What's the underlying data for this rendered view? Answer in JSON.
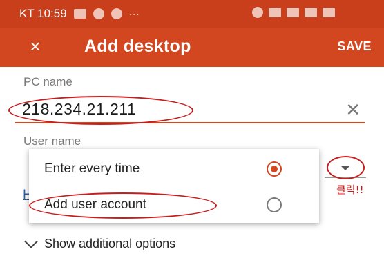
{
  "status_bar": {
    "carrier_time": "KT 10:59",
    "more": "···"
  },
  "app_bar": {
    "close_icon": "×",
    "title": "Add desktop",
    "save_label": "SAVE"
  },
  "form": {
    "pc_name_label": "PC name",
    "pc_name_value": "218.234.21.211",
    "clear_icon": "✕",
    "user_name_label": "User name"
  },
  "menu": {
    "items": [
      {
        "label": "Enter every time",
        "selected": true
      },
      {
        "label": "Add user account",
        "selected": false
      }
    ]
  },
  "annotation": {
    "click_text": "클릭!!",
    "color": "#c81d1d"
  },
  "partial_link": "H",
  "additional_options": "Show additional options",
  "colors": {
    "accent": "#d2471f",
    "status_bar": "#c93e1b"
  }
}
